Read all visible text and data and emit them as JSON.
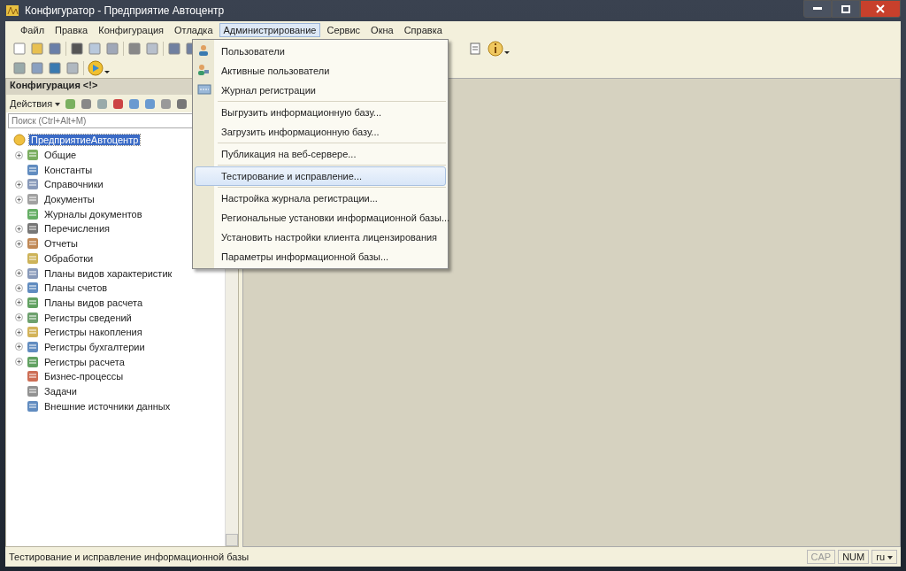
{
  "window": {
    "title": "Конфигуратор - Предприятие Автоцентр"
  },
  "menu": [
    {
      "label": "Файл",
      "selected": false
    },
    {
      "label": "Правка",
      "selected": false
    },
    {
      "label": "Конфигурация",
      "selected": false
    },
    {
      "label": "Отладка",
      "selected": false
    },
    {
      "label": "Администрирование",
      "selected": true
    },
    {
      "label": "Сервис",
      "selected": false
    },
    {
      "label": "Окна",
      "selected": false
    },
    {
      "label": "Справка",
      "selected": false
    }
  ],
  "dropdown": [
    {
      "label": "Пользователи",
      "kind": "user",
      "separator_before": false,
      "selected": false
    },
    {
      "label": "Активные пользователи",
      "kind": "users",
      "separator_before": false,
      "selected": false
    },
    {
      "label": "Журнал регистрации",
      "kind": "log",
      "separator_before": false,
      "selected": false
    },
    {
      "label": "Выгрузить информационную базу...",
      "kind": "plain",
      "separator_before": true,
      "selected": false
    },
    {
      "label": "Загрузить информационную базу...",
      "kind": "plain",
      "separator_before": false,
      "selected": false
    },
    {
      "label": "Публикация на веб-сервере...",
      "kind": "plain",
      "separator_before": true,
      "selected": false
    },
    {
      "label": "Тестирование и исправление...",
      "kind": "plain",
      "separator_before": true,
      "selected": true
    },
    {
      "label": "Настройка журнала регистрации...",
      "kind": "plain",
      "separator_before": true,
      "selected": false
    },
    {
      "label": "Региональные установки информационной базы...",
      "kind": "plain",
      "separator_before": false,
      "selected": false
    },
    {
      "label": "Установить настройки клиента лицензирования",
      "kind": "plain",
      "separator_before": false,
      "selected": false
    },
    {
      "label": "Параметры информационной базы...",
      "kind": "plain",
      "separator_before": false,
      "selected": false
    }
  ],
  "panel": {
    "title": "Конфигурация <!>",
    "actions": "Действия",
    "search": {
      "placeholder": "Поиск (Ctrl+Alt+M)"
    }
  },
  "tree": [
    {
      "label": "ПредприятиеАвтоцентр",
      "selected": true,
      "children": [
        {
          "label": "Общие",
          "expandable": true,
          "selected": false
        },
        {
          "label": "Константы",
          "expandable": false,
          "selected": false
        },
        {
          "label": "Справочники",
          "expandable": true,
          "selected": false
        },
        {
          "label": "Документы",
          "expandable": true,
          "selected": false
        },
        {
          "label": "Журналы документов",
          "expandable": false,
          "selected": false
        },
        {
          "label": "Перечисления",
          "expandable": true,
          "selected": false
        },
        {
          "label": "Отчеты",
          "expandable": true,
          "selected": false
        },
        {
          "label": "Обработки",
          "expandable": false,
          "selected": false
        },
        {
          "label": "Планы видов характеристик",
          "expandable": true,
          "selected": false
        },
        {
          "label": "Планы счетов",
          "expandable": true,
          "selected": false
        },
        {
          "label": "Планы видов расчета",
          "expandable": true,
          "selected": false
        },
        {
          "label": "Регистры сведений",
          "expandable": true,
          "selected": false
        },
        {
          "label": "Регистры накопления",
          "expandable": true,
          "selected": false
        },
        {
          "label": "Регистры бухгалтерии",
          "expandable": true,
          "selected": false
        },
        {
          "label": "Регистры расчета",
          "expandable": true,
          "selected": false
        },
        {
          "label": "Бизнес-процессы",
          "expandable": false,
          "selected": false
        },
        {
          "label": "Задачи",
          "expandable": false,
          "selected": false
        },
        {
          "label": "Внешние источники данных",
          "expandable": false,
          "selected": false
        }
      ]
    }
  ],
  "status_bar": {
    "text": "Тестирование и исправление информационной базы",
    "indicators": [
      {
        "label": "CAP",
        "on": false
      },
      {
        "label": "NUM",
        "on": true
      }
    ],
    "language": "ru"
  }
}
